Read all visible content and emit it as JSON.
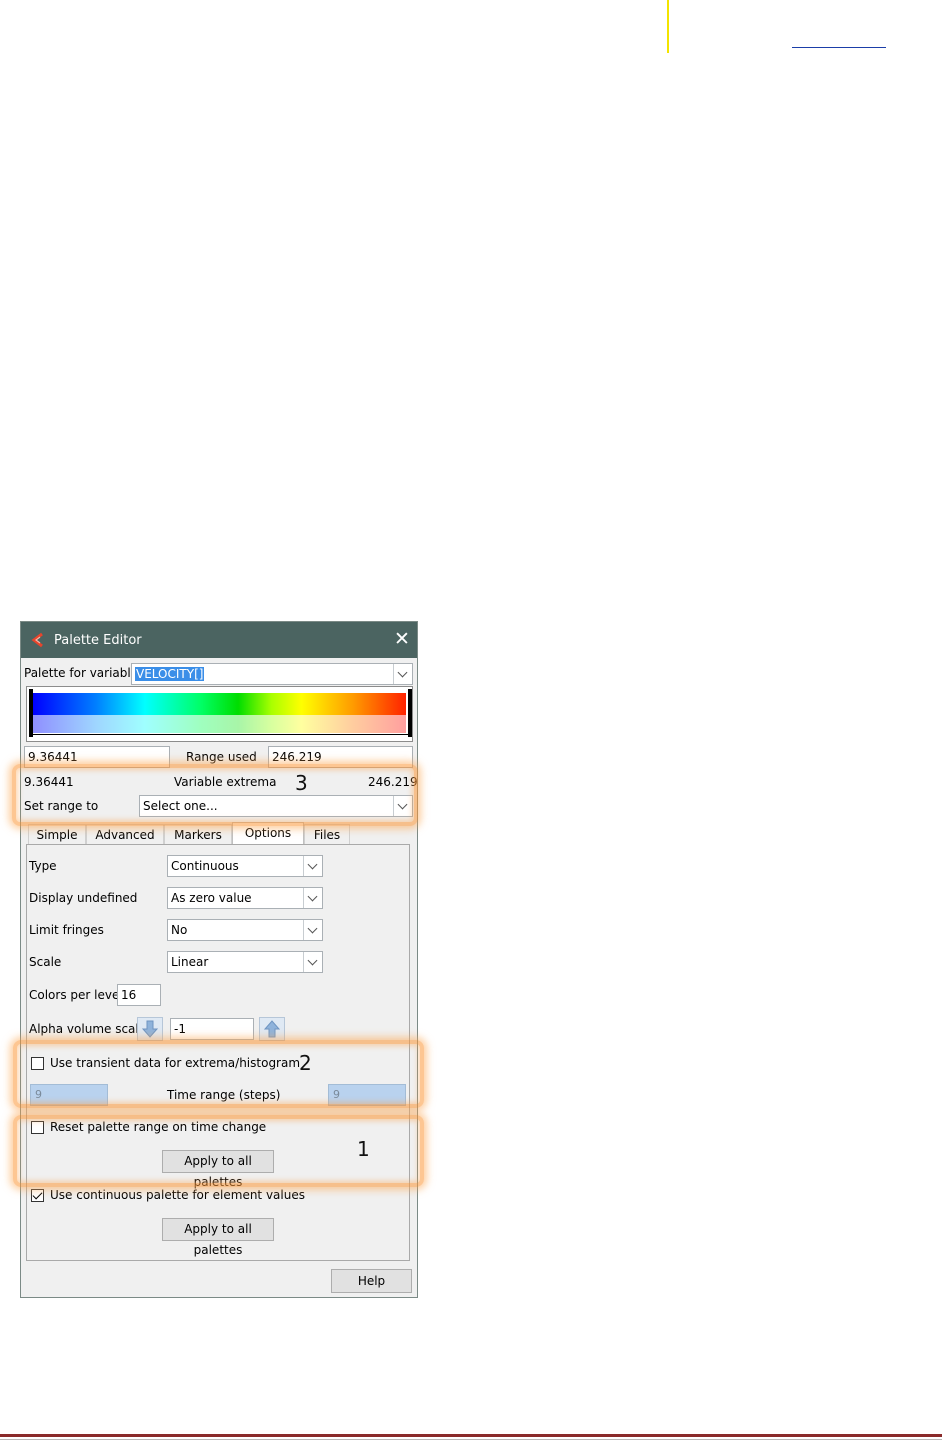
{
  "window": {
    "title": "Palette Editor",
    "close_glyph": "✕"
  },
  "variable": {
    "label": "Palette for variable",
    "value": "VELOCITY[]"
  },
  "range": {
    "min_value": "9.36441",
    "used_label": "Range used",
    "max_value": "246.219"
  },
  "extrema": {
    "min": "9.36441",
    "label": "Variable extrema",
    "max": "246.219"
  },
  "set_range": {
    "label": "Set range to",
    "value": "Select one..."
  },
  "tabs": [
    {
      "label": "Simple"
    },
    {
      "label": "Advanced"
    },
    {
      "label": "Markers"
    },
    {
      "label": "Options"
    },
    {
      "label": "Files"
    }
  ],
  "options": {
    "type": {
      "label": "Type",
      "value": "Continuous"
    },
    "display_undefined": {
      "label": "Display undefined",
      "value": "As zero value"
    },
    "limit_fringes": {
      "label": "Limit fringes",
      "value": "No"
    },
    "scale": {
      "label": "Scale",
      "value": "Linear"
    },
    "colors_per_level": {
      "label": "Colors per level",
      "value": "16"
    },
    "alpha_volume_scale": {
      "label": "Alpha volume scale",
      "value": "-1"
    },
    "transient": {
      "label": "Use transient data for extrema/histogram",
      "checked": false
    },
    "time_range": {
      "label": "Time range (steps)",
      "from": "9",
      "to": "9"
    },
    "reset_range": {
      "label": "Reset palette range on time change",
      "checked": false,
      "apply_label": "Apply to all palettes"
    },
    "continuous_element": {
      "label": "Use continuous palette for element values",
      "checked": true,
      "apply_label": "Apply to all palettes"
    }
  },
  "help_label": "Help",
  "annotations": {
    "one": "1",
    "two": "2",
    "three": "3"
  },
  "colors": {
    "titlebar": "#4b6461",
    "highlight": "#fb9838",
    "selection": "#3a8ee8"
  }
}
